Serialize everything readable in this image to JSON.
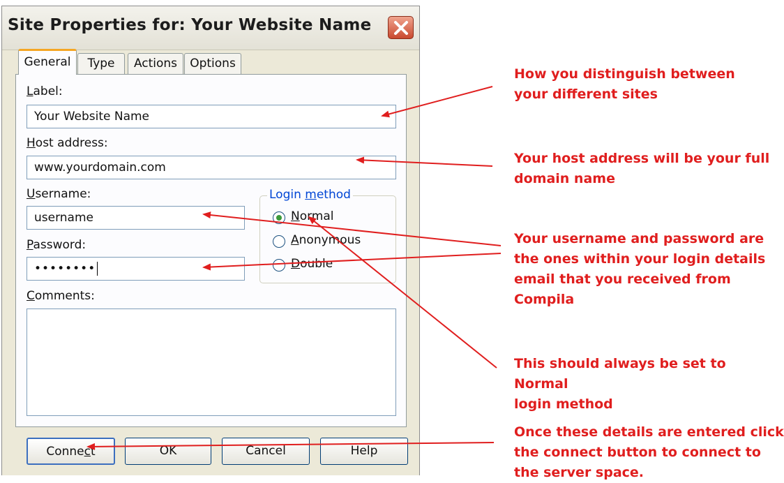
{
  "dialog": {
    "title": "Site Properties for: Your Website Name",
    "tabs": [
      {
        "label": "General",
        "active": true
      },
      {
        "label": "Type",
        "active": false
      },
      {
        "label": "Actions",
        "active": false
      },
      {
        "label": "Options",
        "active": false
      }
    ],
    "label_field": {
      "label_prefix": "",
      "label_accel": "L",
      "label_rest": "abel:",
      "value": "Your Website Name"
    },
    "host_field": {
      "label_accel": "H",
      "label_rest": "ost address:",
      "value": "www.yourdomain.com"
    },
    "username_field": {
      "label_accel": "U",
      "label_rest": "sername:",
      "value": "username"
    },
    "password_field": {
      "label_accel": "P",
      "label_rest": "assword:",
      "value": "••••••••"
    },
    "comments_field": {
      "label_accel": "C",
      "label_rest": "omments:",
      "value": ""
    },
    "login_method": {
      "legend_prefix": "Login ",
      "legend_accel": "m",
      "legend_rest": "ethod",
      "options": [
        {
          "label_accel": "N",
          "label_rest": "ormal",
          "selected": true
        },
        {
          "label_accel": "A",
          "label_rest": "nonymous",
          "selected": false
        },
        {
          "label_accel": "D",
          "label_rest": "ouble",
          "selected": false
        }
      ]
    },
    "buttons": {
      "connect_prefix": "Conne",
      "connect_accel": "c",
      "connect_rest": "t",
      "ok": "OK",
      "cancel": "Cancel",
      "help": "Help"
    }
  },
  "annotations": [
    "How you distinguish between\nyour different sites",
    "Your host address will be your full\ndomain name",
    "Your username and password are\nthe ones within your login details\nemail that you received from Compila",
    "This should always be set to Normal\nlogin method",
    "Once these details are entered click\nthe connect button to connect to\nthe server space."
  ],
  "colors": {
    "annotation": "#e01e1e",
    "tab_highlight": "#f5a623",
    "dialog_bg": "#ece9d8"
  }
}
